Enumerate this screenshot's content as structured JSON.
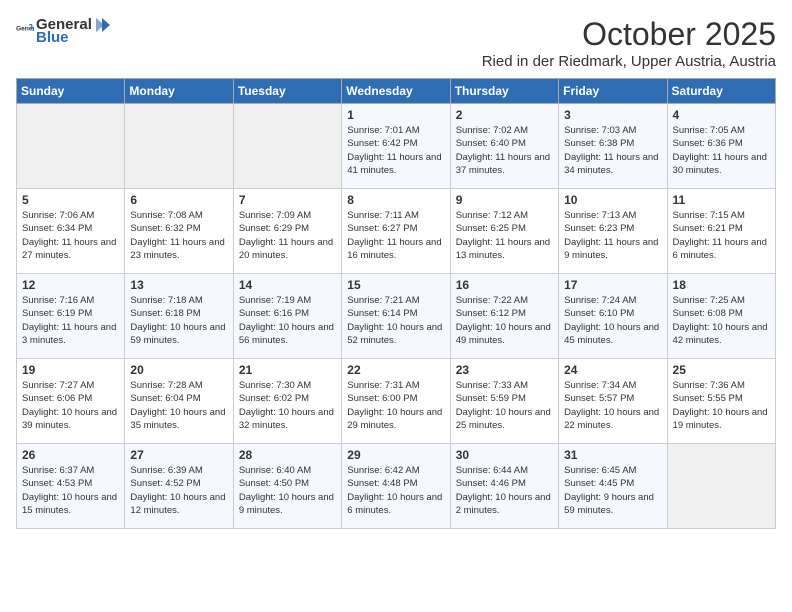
{
  "header": {
    "logo_general": "General",
    "logo_blue": "Blue",
    "month": "October 2025",
    "location": "Ried in der Riedmark, Upper Austria, Austria"
  },
  "days_of_week": [
    "Sunday",
    "Monday",
    "Tuesday",
    "Wednesday",
    "Thursday",
    "Friday",
    "Saturday"
  ],
  "weeks": [
    [
      {
        "day": "",
        "info": ""
      },
      {
        "day": "",
        "info": ""
      },
      {
        "day": "",
        "info": ""
      },
      {
        "day": "1",
        "info": "Sunrise: 7:01 AM\nSunset: 6:42 PM\nDaylight: 11 hours and 41 minutes."
      },
      {
        "day": "2",
        "info": "Sunrise: 7:02 AM\nSunset: 6:40 PM\nDaylight: 11 hours and 37 minutes."
      },
      {
        "day": "3",
        "info": "Sunrise: 7:03 AM\nSunset: 6:38 PM\nDaylight: 11 hours and 34 minutes."
      },
      {
        "day": "4",
        "info": "Sunrise: 7:05 AM\nSunset: 6:36 PM\nDaylight: 11 hours and 30 minutes."
      }
    ],
    [
      {
        "day": "5",
        "info": "Sunrise: 7:06 AM\nSunset: 6:34 PM\nDaylight: 11 hours and 27 minutes."
      },
      {
        "day": "6",
        "info": "Sunrise: 7:08 AM\nSunset: 6:32 PM\nDaylight: 11 hours and 23 minutes."
      },
      {
        "day": "7",
        "info": "Sunrise: 7:09 AM\nSunset: 6:29 PM\nDaylight: 11 hours and 20 minutes."
      },
      {
        "day": "8",
        "info": "Sunrise: 7:11 AM\nSunset: 6:27 PM\nDaylight: 11 hours and 16 minutes."
      },
      {
        "day": "9",
        "info": "Sunrise: 7:12 AM\nSunset: 6:25 PM\nDaylight: 11 hours and 13 minutes."
      },
      {
        "day": "10",
        "info": "Sunrise: 7:13 AM\nSunset: 6:23 PM\nDaylight: 11 hours and 9 minutes."
      },
      {
        "day": "11",
        "info": "Sunrise: 7:15 AM\nSunset: 6:21 PM\nDaylight: 11 hours and 6 minutes."
      }
    ],
    [
      {
        "day": "12",
        "info": "Sunrise: 7:16 AM\nSunset: 6:19 PM\nDaylight: 11 hours and 3 minutes."
      },
      {
        "day": "13",
        "info": "Sunrise: 7:18 AM\nSunset: 6:18 PM\nDaylight: 10 hours and 59 minutes."
      },
      {
        "day": "14",
        "info": "Sunrise: 7:19 AM\nSunset: 6:16 PM\nDaylight: 10 hours and 56 minutes."
      },
      {
        "day": "15",
        "info": "Sunrise: 7:21 AM\nSunset: 6:14 PM\nDaylight: 10 hours and 52 minutes."
      },
      {
        "day": "16",
        "info": "Sunrise: 7:22 AM\nSunset: 6:12 PM\nDaylight: 10 hours and 49 minutes."
      },
      {
        "day": "17",
        "info": "Sunrise: 7:24 AM\nSunset: 6:10 PM\nDaylight: 10 hours and 45 minutes."
      },
      {
        "day": "18",
        "info": "Sunrise: 7:25 AM\nSunset: 6:08 PM\nDaylight: 10 hours and 42 minutes."
      }
    ],
    [
      {
        "day": "19",
        "info": "Sunrise: 7:27 AM\nSunset: 6:06 PM\nDaylight: 10 hours and 39 minutes."
      },
      {
        "day": "20",
        "info": "Sunrise: 7:28 AM\nSunset: 6:04 PM\nDaylight: 10 hours and 35 minutes."
      },
      {
        "day": "21",
        "info": "Sunrise: 7:30 AM\nSunset: 6:02 PM\nDaylight: 10 hours and 32 minutes."
      },
      {
        "day": "22",
        "info": "Sunrise: 7:31 AM\nSunset: 6:00 PM\nDaylight: 10 hours and 29 minutes."
      },
      {
        "day": "23",
        "info": "Sunrise: 7:33 AM\nSunset: 5:59 PM\nDaylight: 10 hours and 25 minutes."
      },
      {
        "day": "24",
        "info": "Sunrise: 7:34 AM\nSunset: 5:57 PM\nDaylight: 10 hours and 22 minutes."
      },
      {
        "day": "25",
        "info": "Sunrise: 7:36 AM\nSunset: 5:55 PM\nDaylight: 10 hours and 19 minutes."
      }
    ],
    [
      {
        "day": "26",
        "info": "Sunrise: 6:37 AM\nSunset: 4:53 PM\nDaylight: 10 hours and 15 minutes."
      },
      {
        "day": "27",
        "info": "Sunrise: 6:39 AM\nSunset: 4:52 PM\nDaylight: 10 hours and 12 minutes."
      },
      {
        "day": "28",
        "info": "Sunrise: 6:40 AM\nSunset: 4:50 PM\nDaylight: 10 hours and 9 minutes."
      },
      {
        "day": "29",
        "info": "Sunrise: 6:42 AM\nSunset: 4:48 PM\nDaylight: 10 hours and 6 minutes."
      },
      {
        "day": "30",
        "info": "Sunrise: 6:44 AM\nSunset: 4:46 PM\nDaylight: 10 hours and 2 minutes."
      },
      {
        "day": "31",
        "info": "Sunrise: 6:45 AM\nSunset: 4:45 PM\nDaylight: 9 hours and 59 minutes."
      },
      {
        "day": "",
        "info": ""
      }
    ]
  ]
}
